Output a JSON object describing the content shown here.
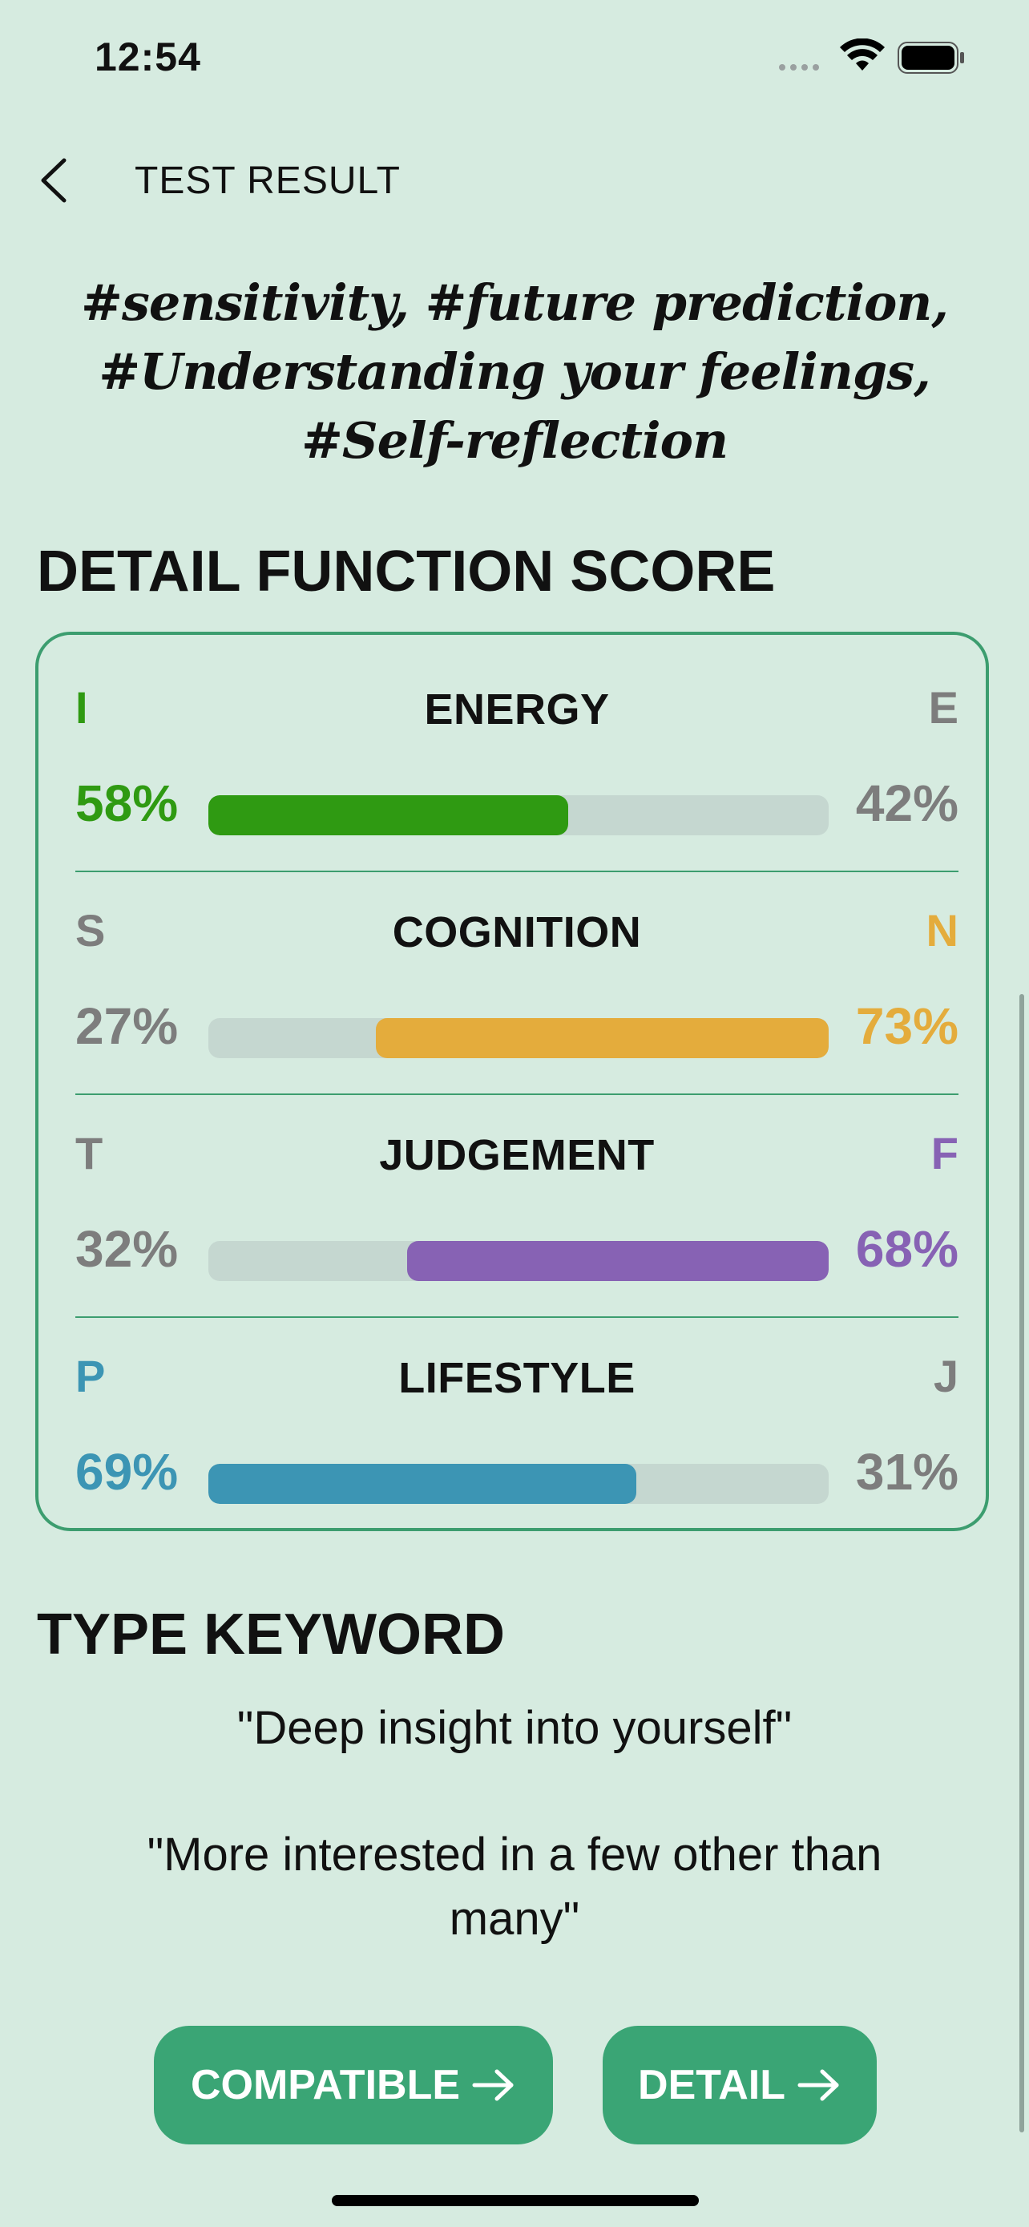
{
  "status": {
    "time": "12:54"
  },
  "header": {
    "title": "TEST RESULT"
  },
  "hashtags": "#sensitivity, #future prediction, #Understanding your feelings, #Self-reflection",
  "detail_section": {
    "title": "DETAIL FUNCTION SCORE",
    "rows": [
      {
        "label": "ENERGY",
        "left_letter": "I",
        "right_letter": "E",
        "left_pct": "58%",
        "right_pct": "42%",
        "dominant": "left",
        "color": "#2f9a12",
        "fill_fraction": 0.58
      },
      {
        "label": "COGNITION",
        "left_letter": "S",
        "right_letter": "N",
        "left_pct": "27%",
        "right_pct": "73%",
        "dominant": "right",
        "color": "#e4ac3c",
        "fill_fraction": 0.73
      },
      {
        "label": "JUDGEMENT",
        "left_letter": "T",
        "right_letter": "F",
        "left_pct": "32%",
        "right_pct": "68%",
        "dominant": "right",
        "color": "#8762b4",
        "fill_fraction": 0.68
      },
      {
        "label": "LIFESTYLE",
        "left_letter": "P",
        "right_letter": "J",
        "left_pct": "69%",
        "right_pct": "31%",
        "dominant": "left",
        "color": "#3c95b4",
        "fill_fraction": 0.69
      }
    ]
  },
  "keyword_section": {
    "title": "TYPE KEYWORD",
    "keywords": [
      "\"Deep insight into yourself\"",
      "\"More interested in a few other than many\""
    ]
  },
  "buttons": {
    "compatible": "COMPATIBLE",
    "detail": "DETAIL"
  },
  "colors": {
    "background": "#d6ebe0",
    "accent": "#3aa575",
    "track": "#c5d7d0",
    "neutral_text": "#7d7d7d"
  },
  "icons": {
    "back": "chevron-left-icon",
    "wifi": "wifi-icon",
    "battery": "battery-icon",
    "arrow": "arrow-right-icon"
  }
}
